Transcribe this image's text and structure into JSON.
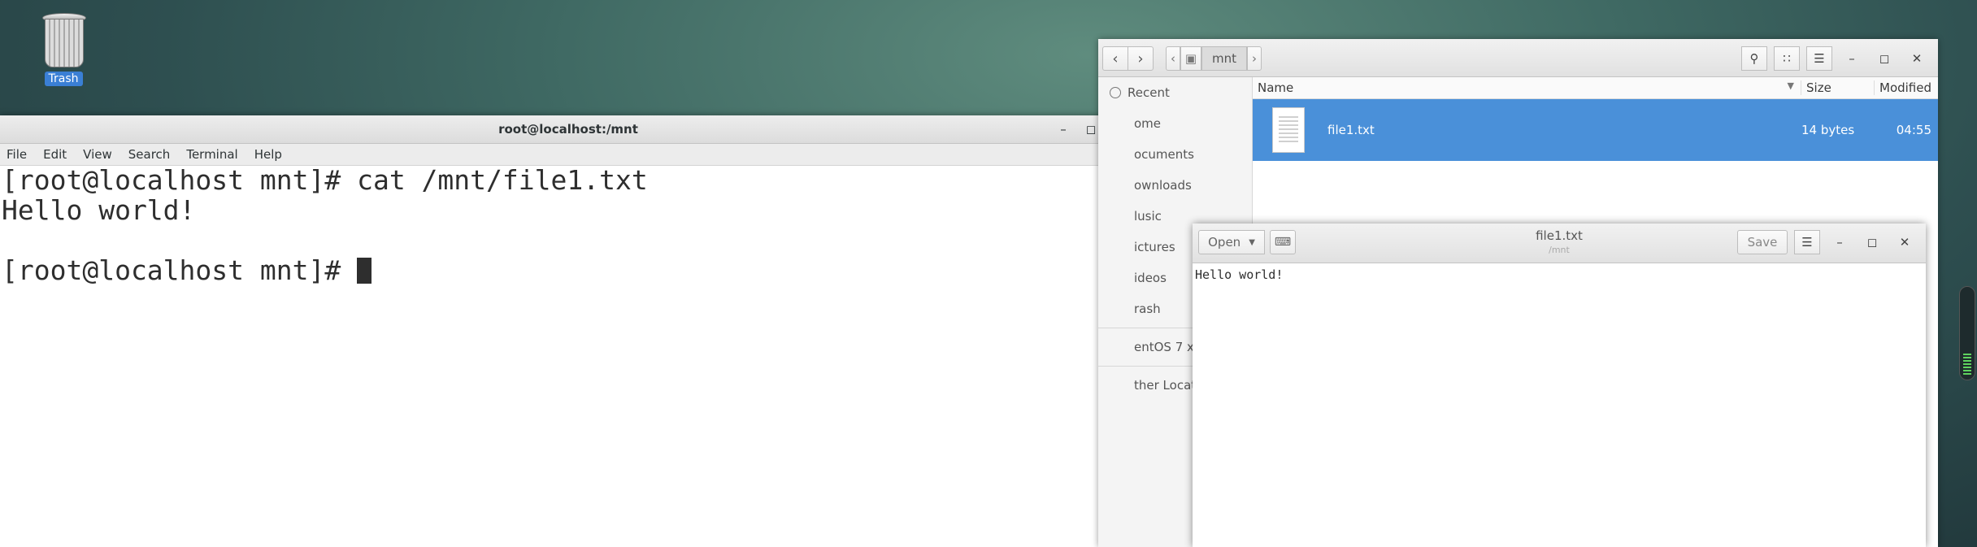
{
  "desktop": {
    "trash_label": "Trash"
  },
  "terminal": {
    "title": "root@localhost:/mnt",
    "menu": [
      "File",
      "Edit",
      "View",
      "Search",
      "Terminal",
      "Help"
    ],
    "lines": [
      "[root@localhost mnt]# cat /mnt/file1.txt",
      "Hello world!",
      "",
      "[root@localhost mnt]# "
    ]
  },
  "files": {
    "path_current": "mnt",
    "sidebar": [
      "Recent",
      "ome",
      "ocuments",
      "ownloads",
      "lusic",
      "ictures",
      "ideos",
      "rash",
      "entOS 7 x8",
      "ther Locati"
    ],
    "columns": {
      "name": "Name",
      "size": "Size",
      "modified": "Modified"
    },
    "rows": [
      {
        "name": "file1.txt",
        "size": "14 bytes",
        "modified": "04:55"
      }
    ]
  },
  "gedit": {
    "open_label": "Open",
    "title": "file1.txt",
    "subtitle": "/mnt",
    "save_label": "Save",
    "content": "Hello world!"
  }
}
